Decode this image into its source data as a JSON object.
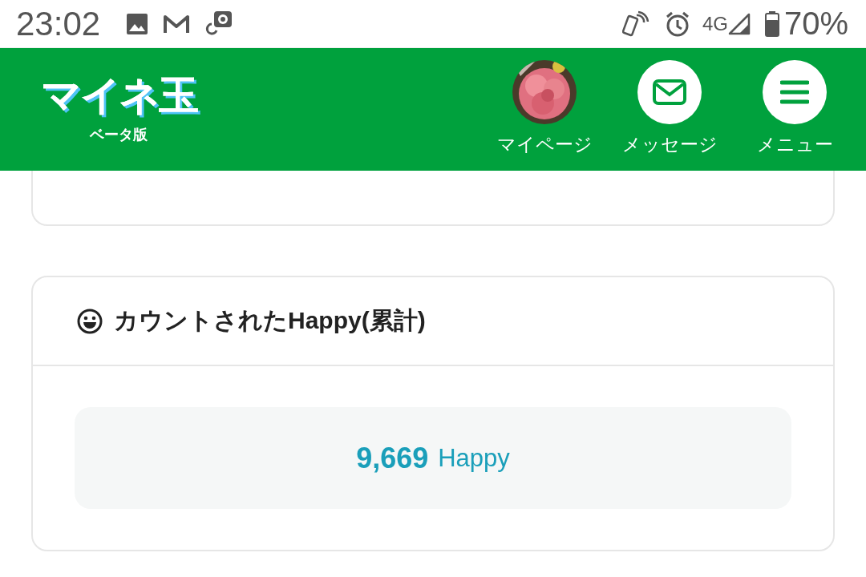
{
  "status_bar": {
    "time": "23:02",
    "network": "4G",
    "battery": "70%"
  },
  "header": {
    "logo": "マイネ玉",
    "logo_sub": "ベータ版",
    "nav": [
      {
        "kind": "avatar",
        "label": "マイページ"
      },
      {
        "kind": "mail",
        "label": "メッセージ"
      },
      {
        "kind": "menu",
        "label": "メニュー"
      }
    ]
  },
  "happy_card": {
    "title": "カウントされたHappy(累計)",
    "count": "9,669",
    "unit": "Happy"
  }
}
